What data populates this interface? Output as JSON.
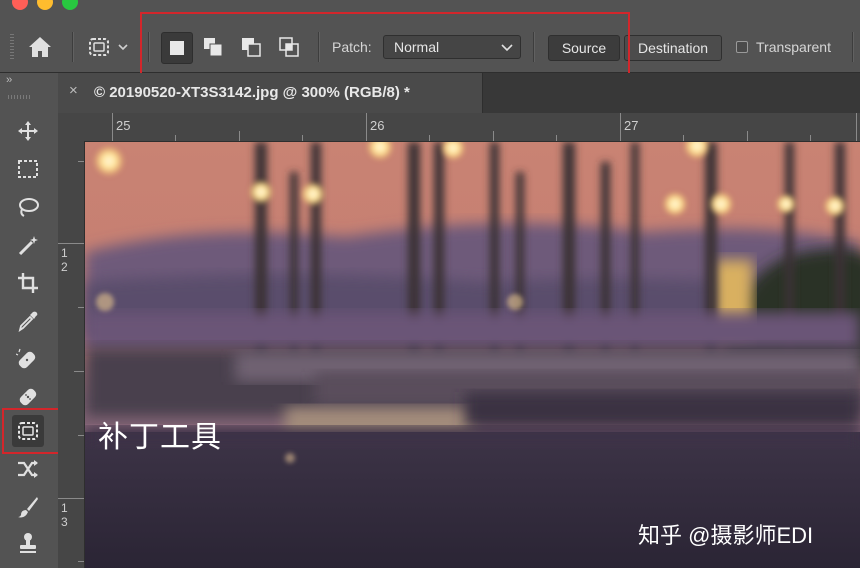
{
  "options_bar": {
    "patch_label": "Patch:",
    "patch_value": "Normal",
    "source_label": "Source",
    "destination_label": "Destination",
    "transparent_label": "Transparent",
    "transparent_checked": false,
    "selection_modes": [
      "new-selection",
      "add-to-selection",
      "subtract-from-selection",
      "intersect-with-selection"
    ],
    "active_mode": "new-selection"
  },
  "document_tab": {
    "title": "© 20190520-XT3S3142.jpg @ 300% (RGB/8) *",
    "close_symbol": "×"
  },
  "rulers": {
    "horizontal": [
      "25",
      "26",
      "27"
    ],
    "vertical": [
      "1",
      "2",
      "1",
      "3"
    ]
  },
  "toolbar": {
    "collapse_symbol": "››",
    "tools": [
      "move-tool",
      "marquee-tool",
      "lasso-tool",
      "magic-wand-tool",
      "crop-tool",
      "eyedropper-tool",
      "spot-healing-brush-tool",
      "healing-brush-tool",
      "patch-tool",
      "content-aware-move-tool",
      "brush-tool",
      "clone-stamp-tool"
    ],
    "active_tool": "patch-tool"
  },
  "canvas": {
    "overlay_text": "补丁工具",
    "watermark": "知乎 @摄影师EDI"
  },
  "colors": {
    "annotation_red": "#d3262b",
    "panel_bg": "#535353"
  }
}
